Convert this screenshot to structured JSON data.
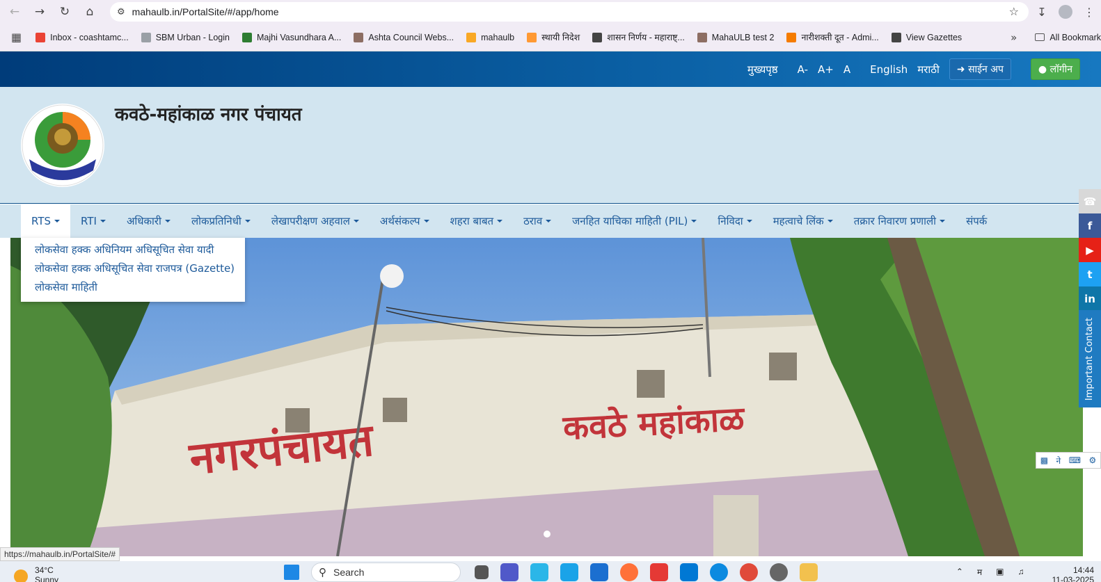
{
  "browser": {
    "url": "mahaulb.in/PortalSite/#/app/home",
    "status_url": "https://mahaulb.in/PortalSite/#"
  },
  "bookmarks": [
    {
      "label": "Inbox - coashtamc...",
      "icon": "gmail-icon",
      "color": "#ea4335"
    },
    {
      "label": "SBM Urban - Login",
      "icon": "sbm-icon",
      "color": "#9aa0a6"
    },
    {
      "label": "Majhi Vasundhara A...",
      "icon": "vasundhara-icon",
      "color": "#2e7d32"
    },
    {
      "label": "Ashta Council Webs...",
      "icon": "ashta-icon",
      "color": "#8d6e63"
    },
    {
      "label": "mahaulb",
      "icon": "mahaulb-icon",
      "color": "#f9a825"
    },
    {
      "label": "स्थायी निदेश",
      "icon": "flag-icon",
      "color": "#ff9933"
    },
    {
      "label": "शासन निर्णय - महाराष्ट्...",
      "icon": "globe-icon",
      "color": "#444444"
    },
    {
      "label": "MahaULB test 2",
      "icon": "mahaulb-test-icon",
      "color": "#8d6e63"
    },
    {
      "label": "नारीशक्ती दूत - Admi...",
      "icon": "narishakti-icon",
      "color": "#f57c00"
    },
    {
      "label": "View Gazettes",
      "icon": "globe-icon",
      "color": "#444444"
    }
  ],
  "bookmarks_all": "All Bookmarks",
  "topnav": {
    "home": "मुख्यपृष्ठ",
    "font_minus": "A-",
    "font_plus": "A+",
    "font_reset": "A",
    "english": "English",
    "marathi": "मराठी",
    "signup": "साईन अप",
    "login": "लॉगीन"
  },
  "header": {
    "title": "कवठे-महांकाळ नगर पंचायत"
  },
  "mainnav": [
    {
      "label": "RTS",
      "caret": true
    },
    {
      "label": "RTI",
      "caret": true
    },
    {
      "label": "अधिकारी",
      "caret": true
    },
    {
      "label": "लोकप्रतिनिधी",
      "caret": true
    },
    {
      "label": "लेखापरीक्षण अहवाल",
      "caret": true
    },
    {
      "label": "अर्थसंकल्प",
      "caret": true
    },
    {
      "label": "शहरा बाबत",
      "caret": true
    },
    {
      "label": "ठराव",
      "caret": true
    },
    {
      "label": "जनहित याचिका माहिती (PIL)",
      "caret": true
    },
    {
      "label": "निविदा",
      "caret": true
    },
    {
      "label": "महत्वाचे लिंक",
      "caret": true
    },
    {
      "label": "तक्रार निवारण प्रणाली",
      "caret": true
    },
    {
      "label": "संपर्क",
      "caret": false
    }
  ],
  "dropdown": [
    "लोकसेवा हक्क अधिनियम अधिसूचित सेवा यादी",
    "लोकसेवा हक्क अधिसूचित सेवा राजपत्र (Gazette)",
    "लोकसेवा माहिती"
  ],
  "banner": {
    "sign_left": "नगरपंचायत",
    "sign_right": "कवठे महांकाळ"
  },
  "side": {
    "important_contact": "Important Contact",
    "keyboard_label": "ने"
  },
  "taskbar": {
    "temperature": "34°C",
    "condition": "Sunny",
    "search_placeholder": "Search",
    "ime": "म",
    "time": "14:44",
    "date": "11-03-2025"
  },
  "colors": {
    "topbar_dark": "#003c7a",
    "nav_link": "#1d5a9a",
    "header_bg": "#d2e5f0",
    "login_green": "#4cae4c"
  }
}
